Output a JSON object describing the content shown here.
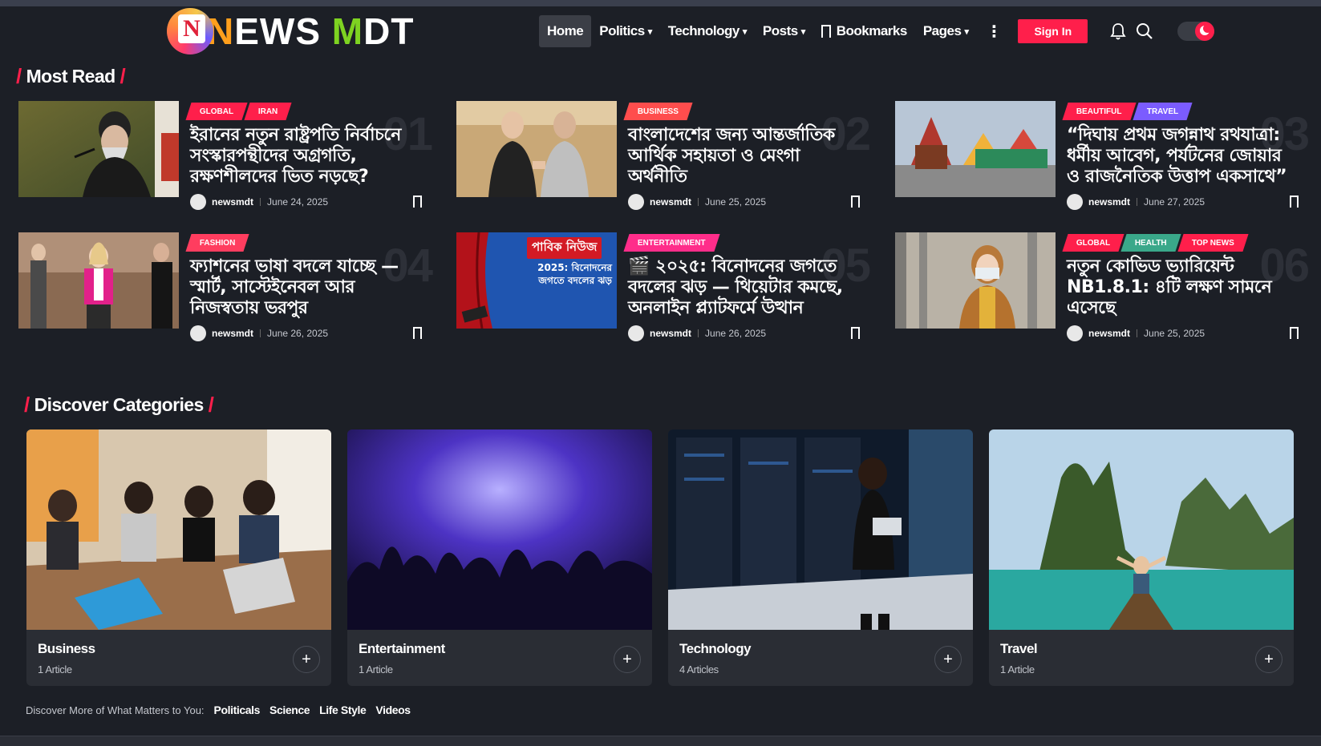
{
  "logo": {
    "n": "N",
    "ews": "EWS ",
    "m": "M",
    "dt": "DT",
    "mark_letter": "N"
  },
  "nav": {
    "home": "Home",
    "politics": "Politics",
    "technology": "Technology",
    "posts": "Posts",
    "bookmarks": "Bookmarks",
    "pages": "Pages",
    "signin": "Sign In"
  },
  "most_read": {
    "title": "Most Read",
    "articles": [
      {
        "rank": "01",
        "tags": [
          {
            "label": "GLOBAL",
            "color": "#ff1f4b"
          },
          {
            "label": "IRAN",
            "color": "#ff1f4b"
          }
        ],
        "title": "ইরানের নতুন রাষ্ট্রপতি নির্বাচনে সংস্কারপন্থীদের অগ্রগতি, রক্ষণশীলদের ভিত নড়ছে?",
        "author": "newsmdt",
        "date": "June 24, 2025"
      },
      {
        "rank": "02",
        "tags": [
          {
            "label": "BUSINESS",
            "color": "#ff4d4d"
          }
        ],
        "title": "বাংলাদেশের জন্য আন্তর্জাতিক আর্থিক সহায়তা ও মেংগা অর্থনীতি",
        "author": "newsmdt",
        "date": "June 25, 2025"
      },
      {
        "rank": "03",
        "tags": [
          {
            "label": "BEAUTIFUL",
            "color": "#ff1f4b"
          },
          {
            "label": "TRAVEL",
            "color": "#7b5cff"
          }
        ],
        "title": "“দিঘায় প্রথম জগন্নাথ রথযাত্রা: ধর্মীয় আবেগ, পর্যটনের জোয়ার ও রাজনৈতিক উত্তাপ একসাথে”",
        "author": "newsmdt",
        "date": "June 27, 2025"
      },
      {
        "rank": "04",
        "tags": [
          {
            "label": "FASHION",
            "color": "#ff3d5f"
          }
        ],
        "title": "ফ্যাশনের ভাষা বদলে যাচ্ছে — স্মার্ট, সাস্টেইনেবল আর নিজস্বতায় ভরপুর",
        "author": "newsmdt",
        "date": "June 26, 2025"
      },
      {
        "rank": "05",
        "tags": [
          {
            "label": "ENTERTAINMENT",
            "color": "#ff2d8a"
          }
        ],
        "title": "🎬 ২০২৫: বিনোদনের জগতে বদলের ঝড় — থিয়েটার কমছে, অনলাইন প্ল্যাটফর্মে উত্থান",
        "author": "newsmdt",
        "date": "June 26, 2025"
      },
      {
        "rank": "06",
        "tags": [
          {
            "label": "GLOBAL",
            "color": "#ff1f4b"
          },
          {
            "label": "HEALTH",
            "color": "#3aa88a"
          },
          {
            "label": "TOP NEWS",
            "color": "#ff1f4b"
          }
        ],
        "title": "নতুন কোভিড ভ্যারিয়েন্ট NB1.8.1: ৪টি লক্ষণ সামনে এসেছে",
        "author": "newsmdt",
        "date": "June 25, 2025"
      }
    ],
    "thumb5_banner": "পাবিক নিউজ",
    "thumb5_text": "2025: বিনোদনের জগতে বদলের ঝড়"
  },
  "discover": {
    "title": "Discover Categories",
    "categories": [
      {
        "name": "Business",
        "count": "1 Article"
      },
      {
        "name": "Entertainment",
        "count": "1 Article"
      },
      {
        "name": "Technology",
        "count": "4 Articles"
      },
      {
        "name": "Travel",
        "count": "1 Article"
      }
    ],
    "more_label": "Discover More of What Matters to You:",
    "more_links": [
      "Politicals",
      "Science",
      "Life Style",
      "Videos"
    ]
  },
  "colors": {
    "accent": "#ff1f4b",
    "background": "#1c1f26",
    "card": "#2a2d34"
  }
}
